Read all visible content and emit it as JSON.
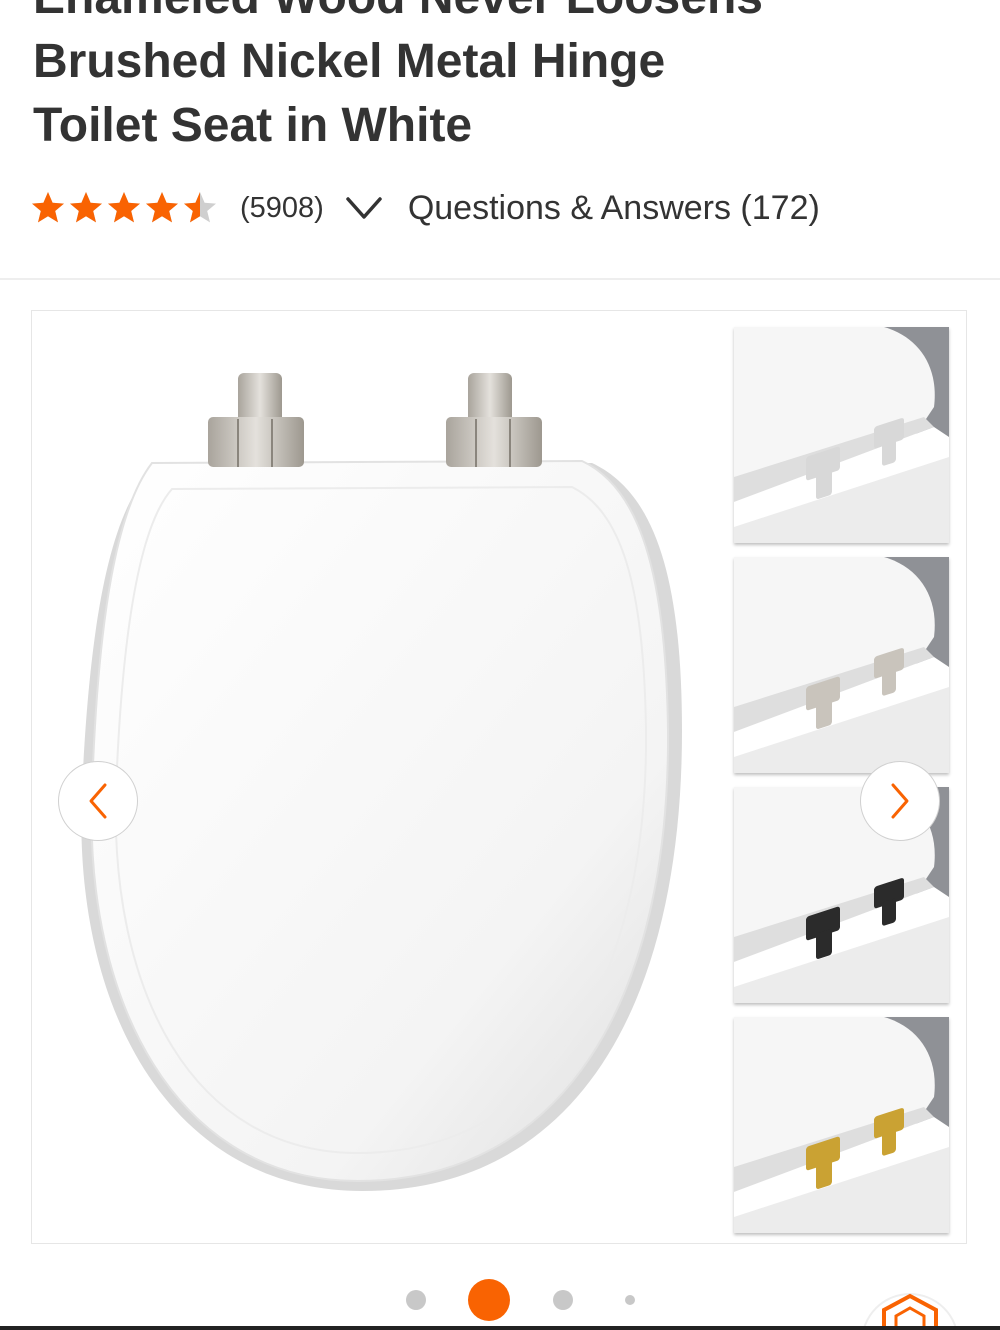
{
  "product": {
    "title_lines": [
      "Enameled Wood Never Loosens",
      "Brushed Nickel Metal Hinge",
      "Toilet Seat in White"
    ],
    "rating": 4.5,
    "rating_max": 5,
    "review_count": "(5908)",
    "qa_link": "Questions & Answers (172)"
  },
  "gallery": {
    "main_image": "white-elongated-toilet-seat-with-brushed-nickel-hinges",
    "thumbnails": [
      {
        "name": "thumbnail-chrome-hinge",
        "hinge_color": "#d8d8d8"
      },
      {
        "name": "thumbnail-brushed-nickel-hinge",
        "hinge_color": "#c9c4bc"
      },
      {
        "name": "thumbnail-black-hinge",
        "hinge_color": "#2b2b2b"
      },
      {
        "name": "thumbnail-gold-hinge",
        "hinge_color": "#caa233"
      }
    ],
    "prev_icon": "chevron-left-icon",
    "next_icon": "chevron-right-icon",
    "pagination": {
      "total": 4,
      "active": 2
    }
  },
  "colors": {
    "accent": "#f96302",
    "star": "#f96302",
    "text": "#333333"
  }
}
